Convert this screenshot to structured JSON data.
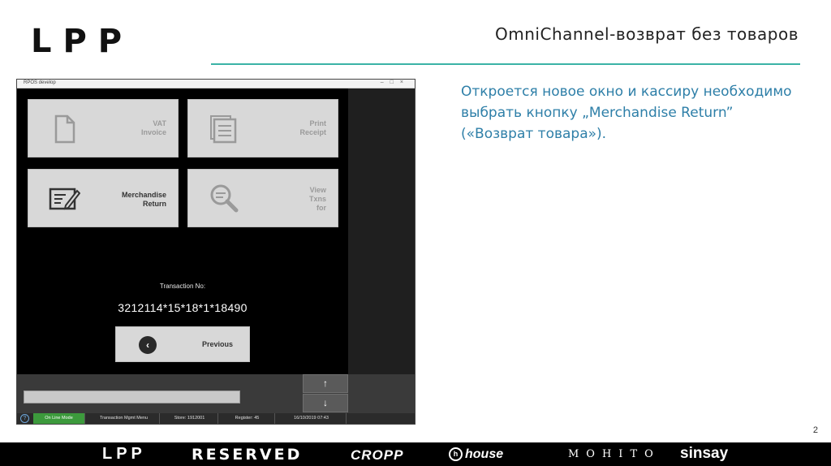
{
  "header": {
    "logo": "LPP",
    "title": "OmniChannel-возврат без товаров",
    "accent_color": "#3bb3a6"
  },
  "pos_window": {
    "title": "RPOS develop",
    "window_controls": "–□×",
    "tiles": [
      {
        "label": "VAT\nInvoice",
        "icon": "document-icon",
        "active": false
      },
      {
        "label": "Print\nReceipt",
        "icon": "receipt-stack-icon",
        "active": false
      },
      {
        "label": "Merchandise\nReturn",
        "icon": "edit-form-icon",
        "active": true
      },
      {
        "label": "View\nTxns\nfor",
        "icon": "magnifier-icon",
        "active": false
      }
    ],
    "transaction_label": "Transaction No:",
    "transaction_number": "3212114*15*18*1*18490",
    "previous_button": "Previous",
    "scroll_up": "↑",
    "scroll_down": "↓",
    "statusbar": {
      "help": "?",
      "mode": "On Line Mode",
      "menu": "Transaction Mgmt Menu",
      "store": "Store: 1912001",
      "register": "Register: 45",
      "datetime": "16/10/2019 07:43",
      "mode_color": "#3c9a3c"
    }
  },
  "description": "Откроется новое окно и кассиру необходимо выбрать кнопку „Merchandise Return” («Возврат товара»).",
  "description_color": "#2e7fa8",
  "page_number": "2",
  "footer_brands": {
    "lpp": "LPP",
    "reserved": "RESERVED",
    "cropp": "CROPP",
    "house": "house",
    "mohito": "MOHITO",
    "sinsay": "sinsay"
  }
}
